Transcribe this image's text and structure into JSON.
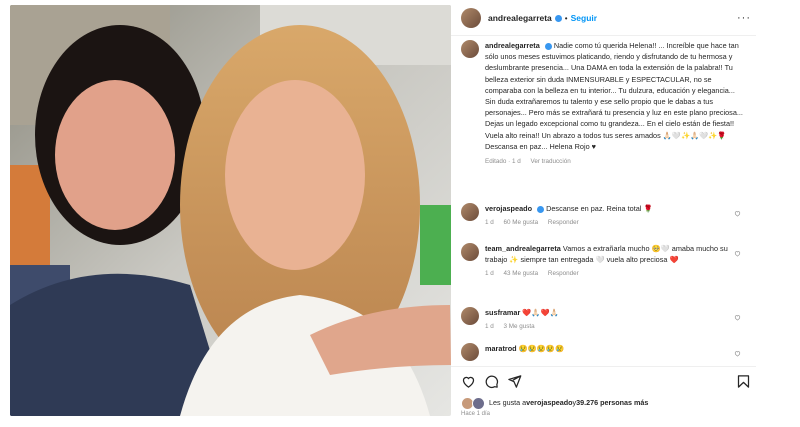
{
  "post": {
    "username": "andrealegarreta",
    "follow_label": "Seguir",
    "more_label": "···",
    "caption_user": "andrealegarreta",
    "caption_text": "Nadie como tú querida Helena!! ... Increíble que hace tan sólo unos meses estuvimos platicando, riendo y disfrutando de tu hermosa y deslumbrante presencia... Una DAMA en toda la extensión de la palabra!! Tu belleza exterior sin duda INMENSURABLE y ESPECTACULAR, no se comparaba con la belleza en tu interior... Tu dulzura, educación y elegancia... Sin duda extrañaremos tu talento y ese sello propio que le dabas a tus personajes... Pero más se extrañará tu presencia y luz en este plano preciosa... Dejas un legado excepcional como tu grandeza... En el cielo están de fiesta!! Vuela alto reina!! Un abrazo a todos tus seres amados 🙏🏻🤍✨🙏🏻🤍✨🌹 Descansa en paz... Helena Rojo ♥",
    "caption_edited": "Editado · 1 d",
    "caption_translate": "Ver traducción"
  },
  "comments": [
    {
      "user": "verojaspeado",
      "text": "Descanse en paz. Reina total 🌹",
      "time": "1 d",
      "likes": "60 Me gusta",
      "reply": "Responder"
    },
    {
      "user": "team_andrealegarreta",
      "text": "Vamos a extrañarla mucho 🥺🤍 amaba mucho su trabajo ✨ siempre tan entregada 🤍 vuela alto preciosa ❤️",
      "time": "1 d",
      "likes": "43 Me gusta",
      "reply": "Responder"
    },
    {
      "user": "susframar",
      "text": "❤️🙏🏻❤️🙏🏻",
      "time": "1 d",
      "likes": "3 Me gusta",
      "reply": ""
    },
    {
      "user": "maratrod",
      "text": "😢😢😢😢😢",
      "time": "",
      "likes": "",
      "reply": ""
    }
  ],
  "likes": {
    "prefix": "Les gusta a ",
    "first_user": "verojaspeado",
    "middle": " y ",
    "count": "39.276 personas más",
    "cutoff": "Hace 1 día"
  },
  "colors": {
    "accent": "#0095f6",
    "verified": "#3897f0",
    "muted": "#8e8e8e"
  },
  "icons": [
    "heart-icon",
    "comment-icon",
    "share-icon",
    "bookmark-icon",
    "verified-icon",
    "more-icon"
  ]
}
